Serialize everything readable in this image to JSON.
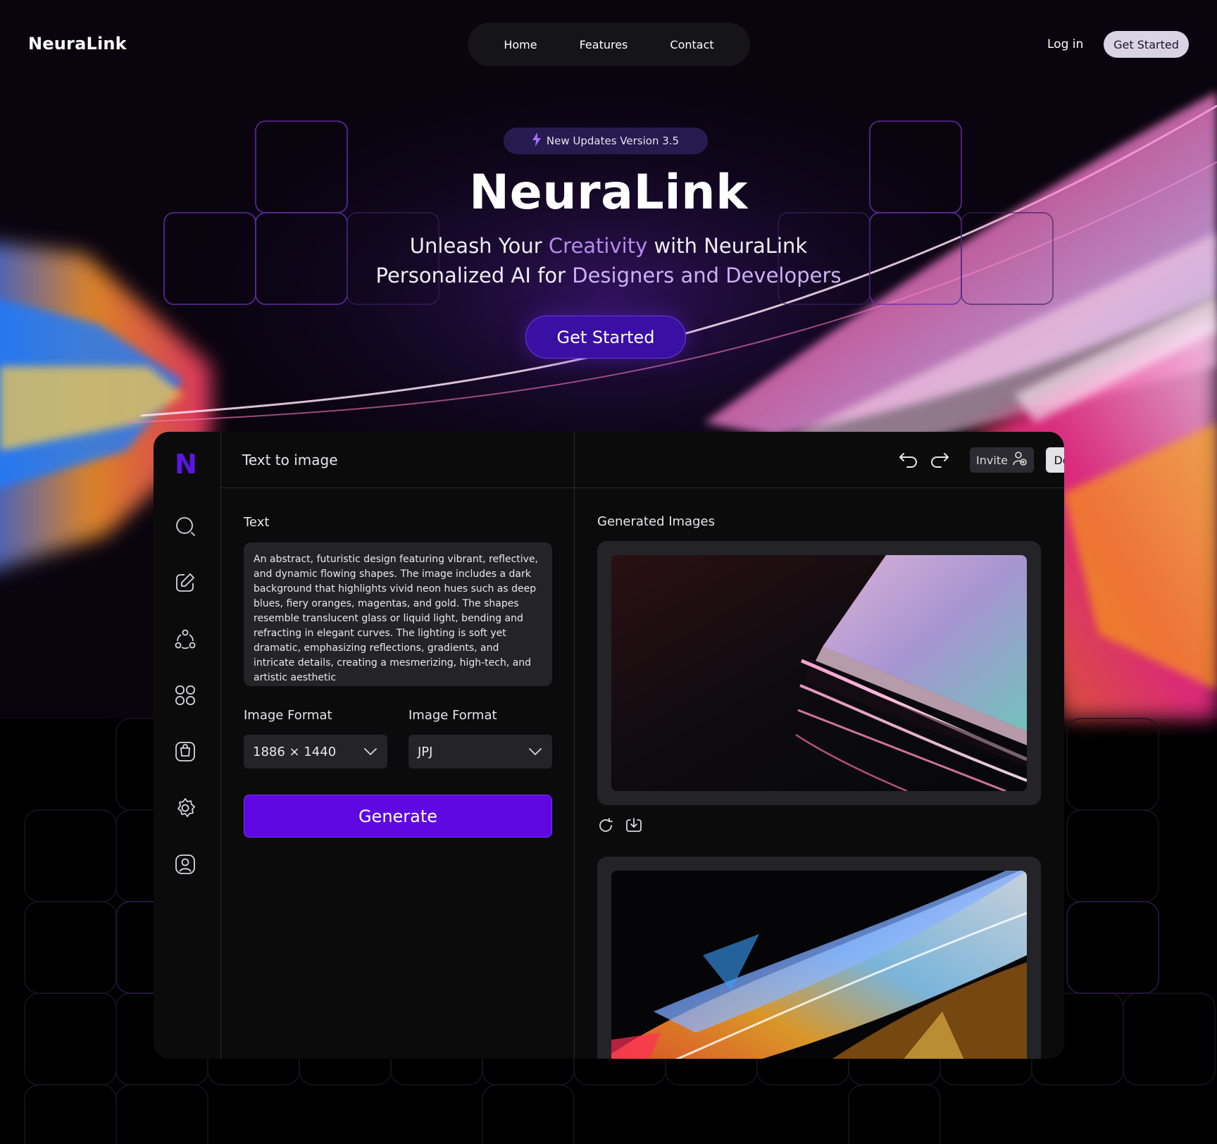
{
  "header": {
    "logo": "NeuraLink",
    "nav": [
      "Home",
      "Features",
      "Contact"
    ],
    "login": "Log in",
    "cta": "Get Started"
  },
  "hero": {
    "badge": "New Updates Version 3.5",
    "title": "NeuraLink",
    "line1_pre": "Unleash Your ",
    "line1_accent": "Creativity",
    "line1_post": " with NeuraLink",
    "line2_pre": "Personalized AI for ",
    "line2_accent": "Designers and Developers",
    "cta": "Get Started"
  },
  "app": {
    "logo_letter": "N",
    "title": "Text to image",
    "invite": "Invite",
    "done": "Done",
    "text_label": "Text",
    "prompt": "An abstract, futuristic design featuring vibrant, reflective, and dynamic flowing shapes. The image includes a dark background that highlights vivid neon hues such as deep blues, fiery oranges, magentas, and gold. The shapes resemble translucent glass or liquid light, bending and refracting in elegant curves. The lighting is soft yet dramatic, emphasizing reflections, gradients, and intricate details, creating a mesmerizing, high-tech, and artistic aesthetic",
    "format1_label": "Image Format",
    "format1_value": "1886 × 1440",
    "format2_label": "Image Format",
    "format2_value": "JPJ",
    "generate": "Generate",
    "generated_label": "Generated Images"
  },
  "icons": {
    "rail": [
      "search-icon",
      "edit-icon",
      "share-icon",
      "grid-icon",
      "bag-icon",
      "settings-icon",
      "user-icon"
    ],
    "actions": [
      "refresh-icon",
      "download-icon"
    ]
  },
  "colors": {
    "accent": "#5f08e2",
    "hero_button": "#3a0fa3",
    "badge": "#251b4e",
    "panel": "#0b0b0c",
    "field": "#232328"
  }
}
